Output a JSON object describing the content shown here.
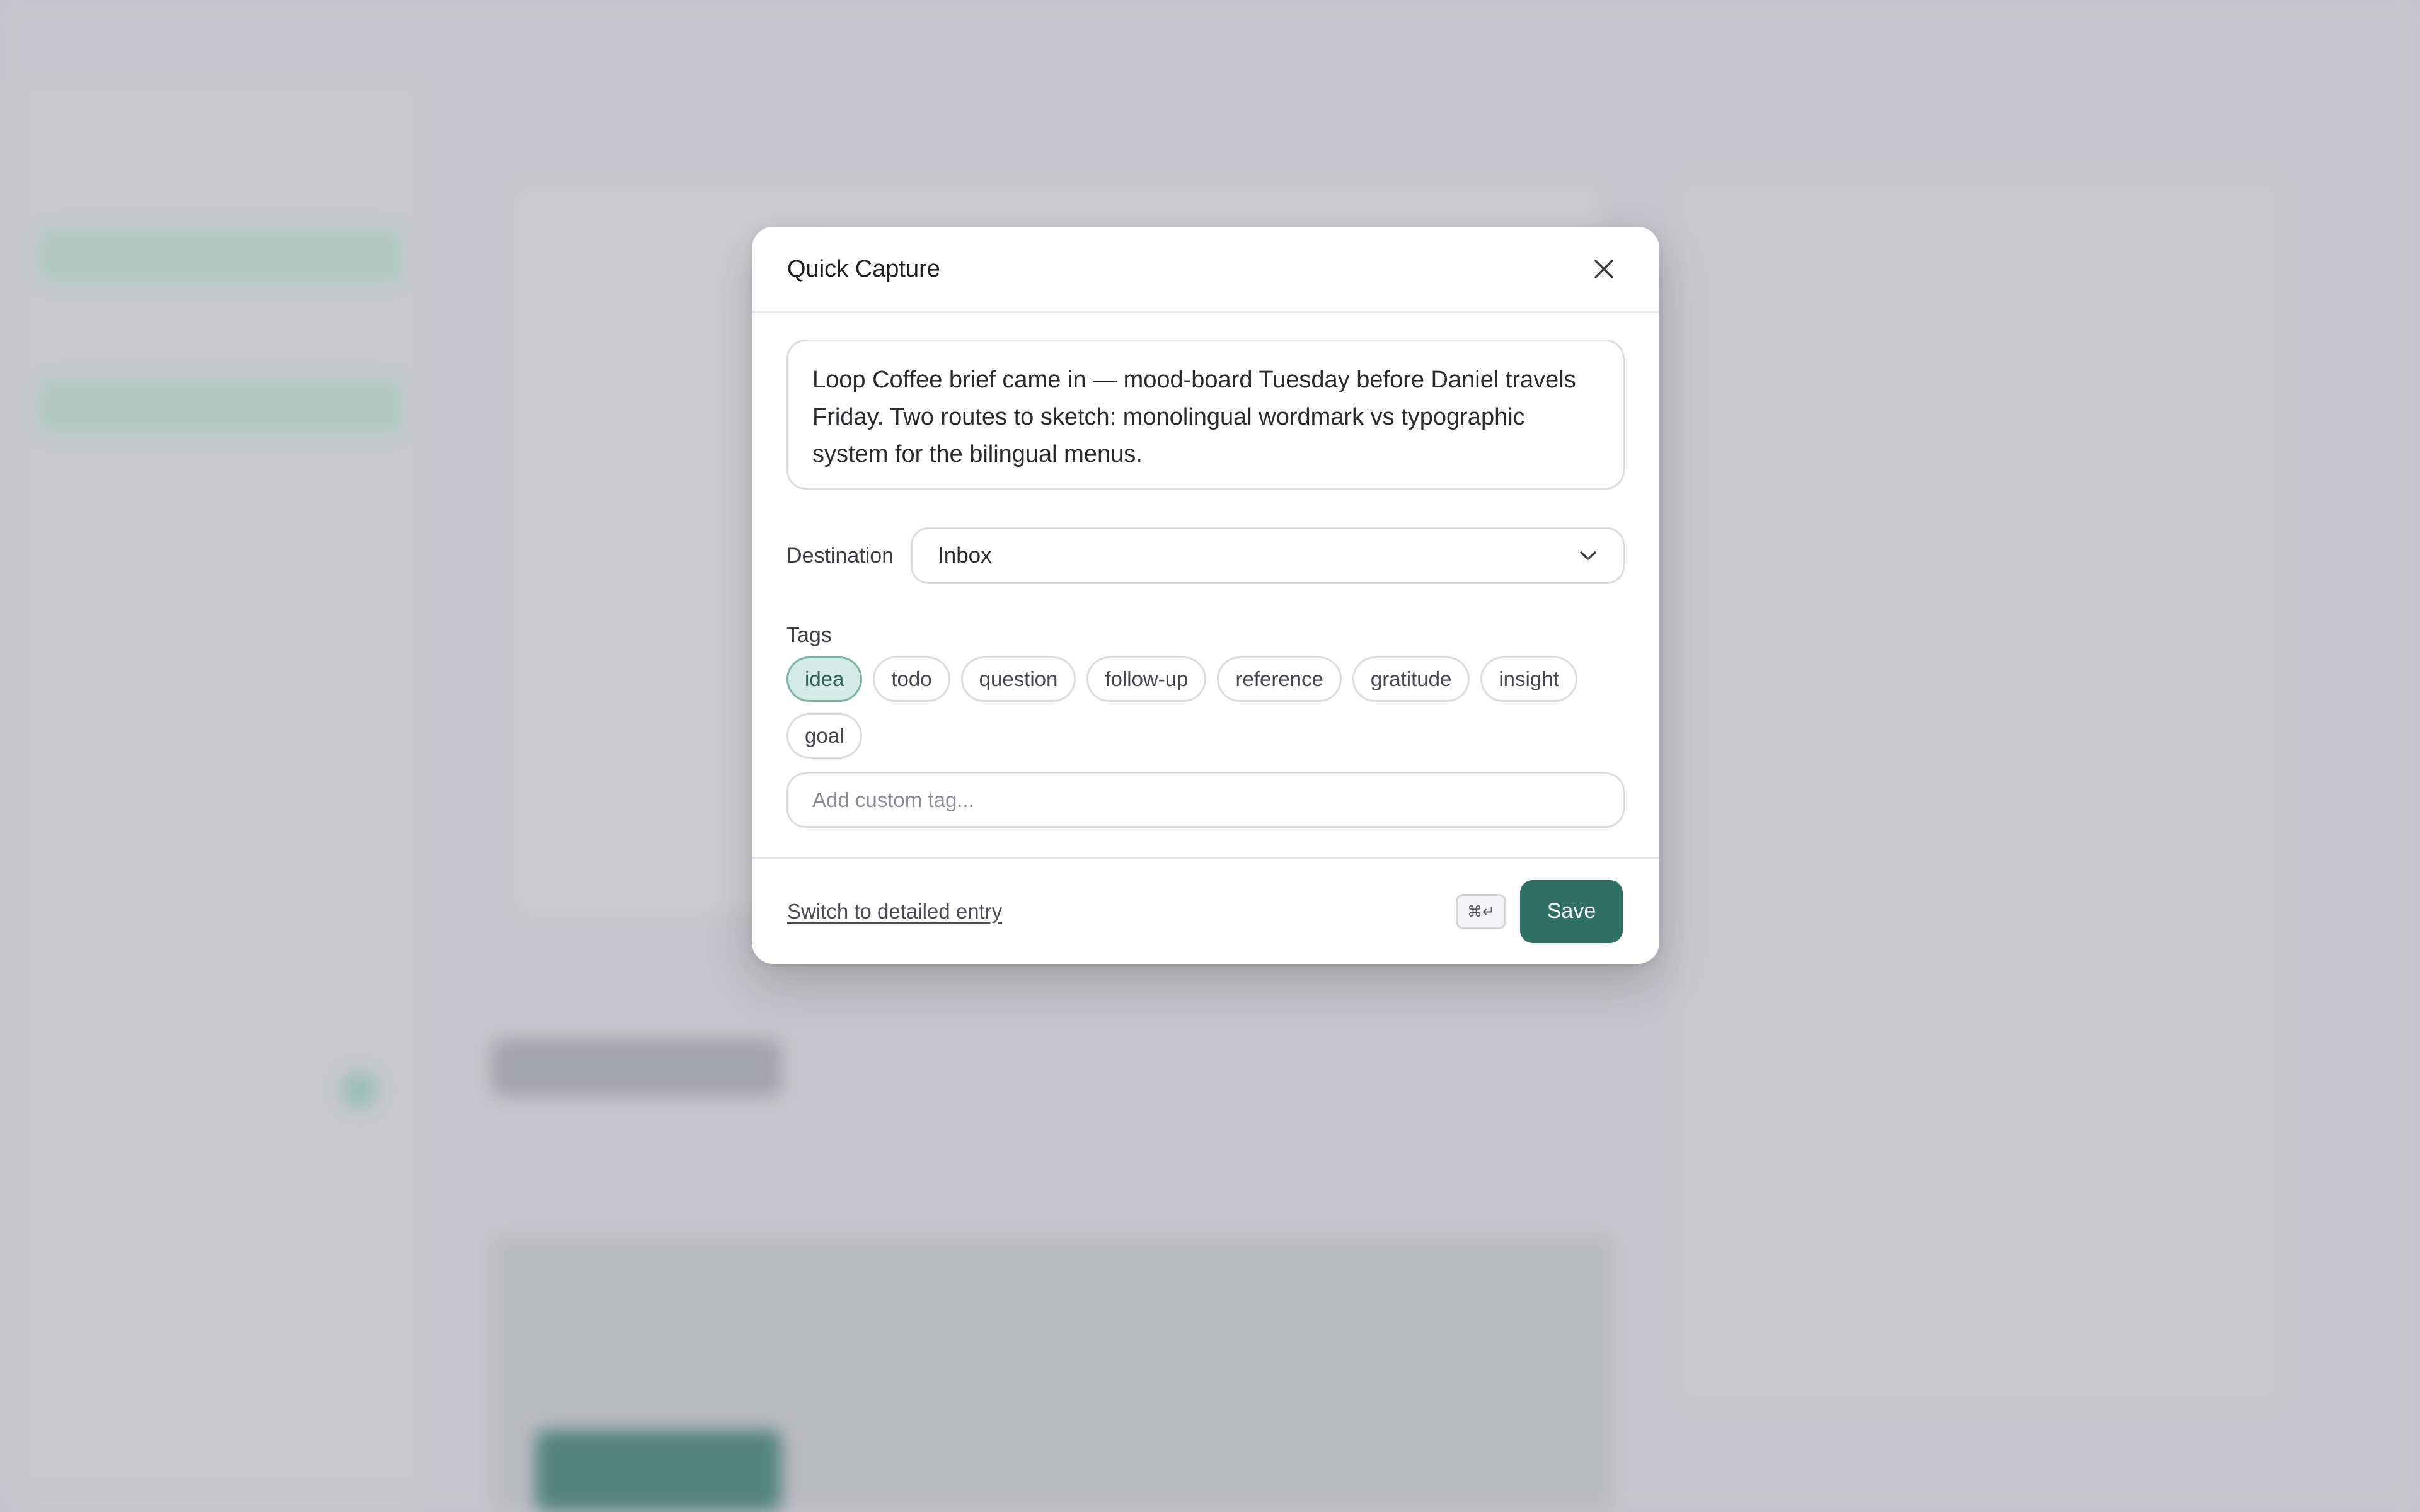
{
  "modal": {
    "title": "Quick Capture",
    "note_text": "Loop Coffee brief came in — mood-board Tuesday before Daniel travels Friday. Two routes to sketch: monolingual wordmark vs typographic system for the bilingual menus.",
    "destination_label": "Destination",
    "destination_value": "Inbox",
    "tags_label": "Tags",
    "tags": [
      {
        "label": "idea",
        "selected": true
      },
      {
        "label": "todo",
        "selected": false
      },
      {
        "label": "question",
        "selected": false
      },
      {
        "label": "follow-up",
        "selected": false
      },
      {
        "label": "reference",
        "selected": false
      },
      {
        "label": "gratitude",
        "selected": false
      },
      {
        "label": "insight",
        "selected": false
      },
      {
        "label": "goal",
        "selected": false
      }
    ],
    "custom_tag_placeholder": "Add custom tag...",
    "detail_link": "Switch to detailed entry",
    "shortcut": "⌘↵",
    "save_label": "Save"
  },
  "colors": {
    "accent": "#2f6f66",
    "tag_selected_bg": "#d4ebe5",
    "tag_selected_border": "#7cb3a6"
  },
  "icons": {
    "close": "close-icon",
    "dropdown": "chevron-down-icon"
  }
}
